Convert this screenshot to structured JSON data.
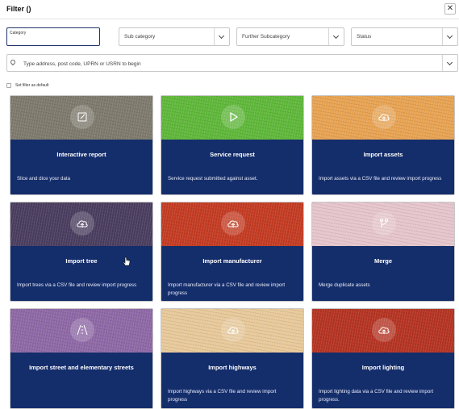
{
  "header": {
    "title": "Filter ()"
  },
  "filters": {
    "category": {
      "label": "Category",
      "value": ""
    },
    "subcategory": {
      "placeholder": "Sub category"
    },
    "further": {
      "placeholder": "Further Subcategory"
    },
    "status": {
      "placeholder": "Status"
    },
    "search": {
      "placeholder": "Type address, post code, UPRN or USRN to begin"
    },
    "set_default_label": "Set filter as default"
  },
  "cards": [
    {
      "title": "Interactive report",
      "description": "Slice and dice your data",
      "color": "#7e7a6d",
      "icon": "edit-icon"
    },
    {
      "title": "Service request",
      "description": "Service request submitted against asset.",
      "color": "#5fb83a",
      "icon": "play-icon"
    },
    {
      "title": "Import assets",
      "description": "Import assets via a CSV file and review import progress",
      "color": "#e8a352",
      "icon": "upload-cloud-icon"
    },
    {
      "title": "Import tree",
      "description": "Import trees via a CSV file and review import progress",
      "color": "#4a3d5f",
      "icon": "upload-cloud-icon"
    },
    {
      "title": "Import manufacturer",
      "description": "Import manufacturer via a CSV file and review import progress",
      "color": "#c43b22",
      "icon": "upload-cloud-icon"
    },
    {
      "title": "Merge",
      "description": "Merge duplicate assets",
      "color": "#e6c5cc",
      "icon": "merge-icon"
    },
    {
      "title": "Import street and elementary streets",
      "description": "",
      "color": "#8e68a6",
      "icon": "road-icon"
    },
    {
      "title": "Import highways",
      "description": "Import highways via a CSV file and review import progress",
      "color": "#e8c99a",
      "icon": "upload-cloud-icon"
    },
    {
      "title": "Import lighting",
      "description": "Import lighting data via a CSV file and review import progress.",
      "color": "#b53322",
      "icon": "upload-cloud-icon"
    }
  ]
}
